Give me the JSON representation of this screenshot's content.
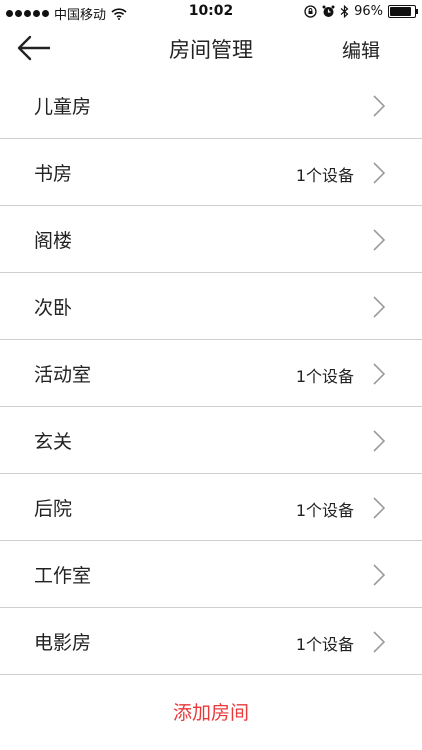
{
  "status_bar": {
    "carrier": "中国移动",
    "time": "10:02",
    "battery": "96%",
    "battery_level": 0.96,
    "icons": [
      "signal-dots-icon",
      "wifi-icon",
      "orientation-lock-icon",
      "alarm-icon",
      "bluetooth-icon",
      "battery-icon"
    ]
  },
  "nav": {
    "title": "房间管理",
    "edit_label": "编辑",
    "back_icon": "back-arrow-icon"
  },
  "rooms": [
    {
      "name": "儿童房",
      "devices": ""
    },
    {
      "name": "书房",
      "devices": "1个设备"
    },
    {
      "name": "阁楼",
      "devices": ""
    },
    {
      "name": "次卧",
      "devices": ""
    },
    {
      "name": "活动室",
      "devices": "1个设备"
    },
    {
      "name": "玄关",
      "devices": ""
    },
    {
      "name": "后院",
      "devices": "1个设备"
    },
    {
      "name": "工作室",
      "devices": ""
    },
    {
      "name": "电影房",
      "devices": "1个设备"
    }
  ],
  "add_room_label": "添加房间",
  "colors": {
    "accent": "#e8393b",
    "divider": "#cfcfcf",
    "chevron": "#9b9b9b"
  }
}
